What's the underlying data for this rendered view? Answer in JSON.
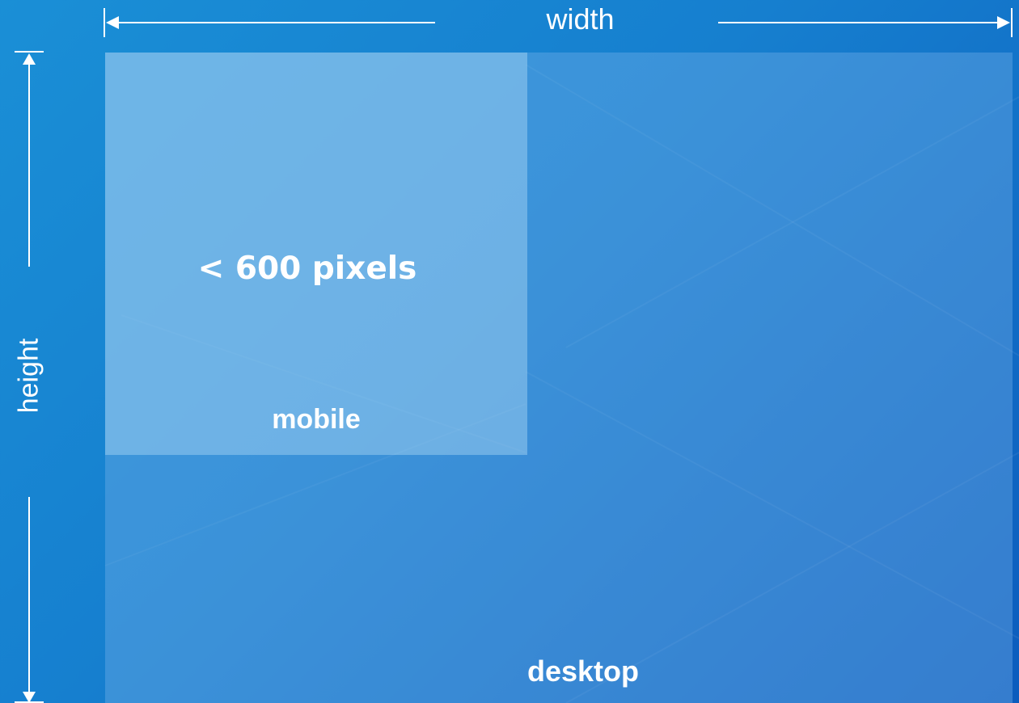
{
  "colors": {
    "background_start": "#1a8fd6",
    "background_end": "#0c5cbd",
    "text": "#ffffff"
  },
  "dimensions": {
    "width_label": "width",
    "height_label": "height"
  },
  "regions": {
    "mobile": {
      "size_label": "< 600 pixels",
      "label": "mobile"
    },
    "desktop": {
      "label": "desktop"
    }
  }
}
